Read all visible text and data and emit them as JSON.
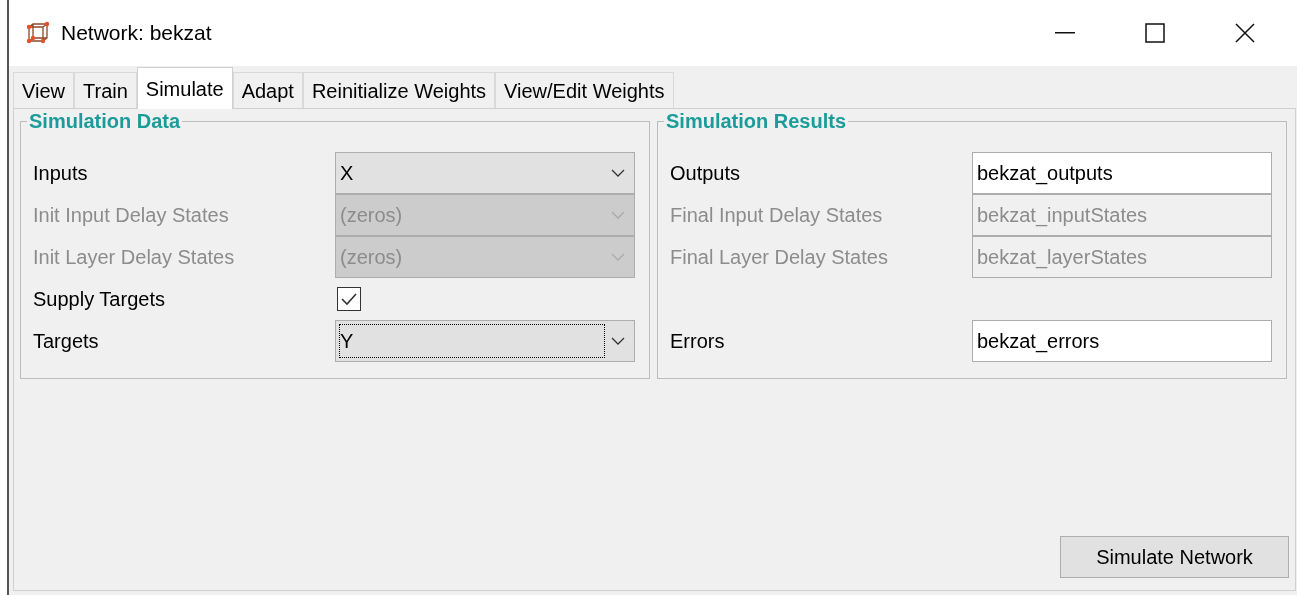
{
  "window": {
    "title": "Network: bekzat"
  },
  "tabs": [
    {
      "label": "View",
      "selected": false
    },
    {
      "label": "Train",
      "selected": false
    },
    {
      "label": "Simulate",
      "selected": true
    },
    {
      "label": "Adapt",
      "selected": false
    },
    {
      "label": "Reinitialize Weights",
      "selected": false
    },
    {
      "label": "View/Edit Weights",
      "selected": false
    }
  ],
  "simulation_data": {
    "title": "Simulation Data",
    "rows": [
      {
        "kind": "combo",
        "label": "Inputs",
        "value": "X",
        "disabled": false,
        "focused": false
      },
      {
        "kind": "combo",
        "label": "Init Input Delay States",
        "value": "(zeros)",
        "disabled": true,
        "focused": false
      },
      {
        "kind": "combo",
        "label": "Init Layer Delay States",
        "value": "(zeros)",
        "disabled": true,
        "focused": false
      },
      {
        "kind": "checkbox",
        "label": "Supply Targets",
        "checked": true
      },
      {
        "kind": "combo",
        "label": "Targets",
        "value": "Y",
        "disabled": false,
        "focused": true
      }
    ]
  },
  "simulation_results": {
    "title": "Simulation Results",
    "rows": [
      {
        "label": "Outputs",
        "value": "bekzat_outputs",
        "disabled": false
      },
      {
        "label": "Final Input Delay States",
        "value": "bekzat_inputStates",
        "disabled": true
      },
      {
        "label": "Final Layer Delay States",
        "value": "bekzat_layerStates",
        "disabled": true
      }
    ],
    "errors": {
      "label": "Errors",
      "value": "bekzat_errors",
      "disabled": false
    }
  },
  "buttons": [
    {
      "label": "Simulate Network"
    }
  ]
}
